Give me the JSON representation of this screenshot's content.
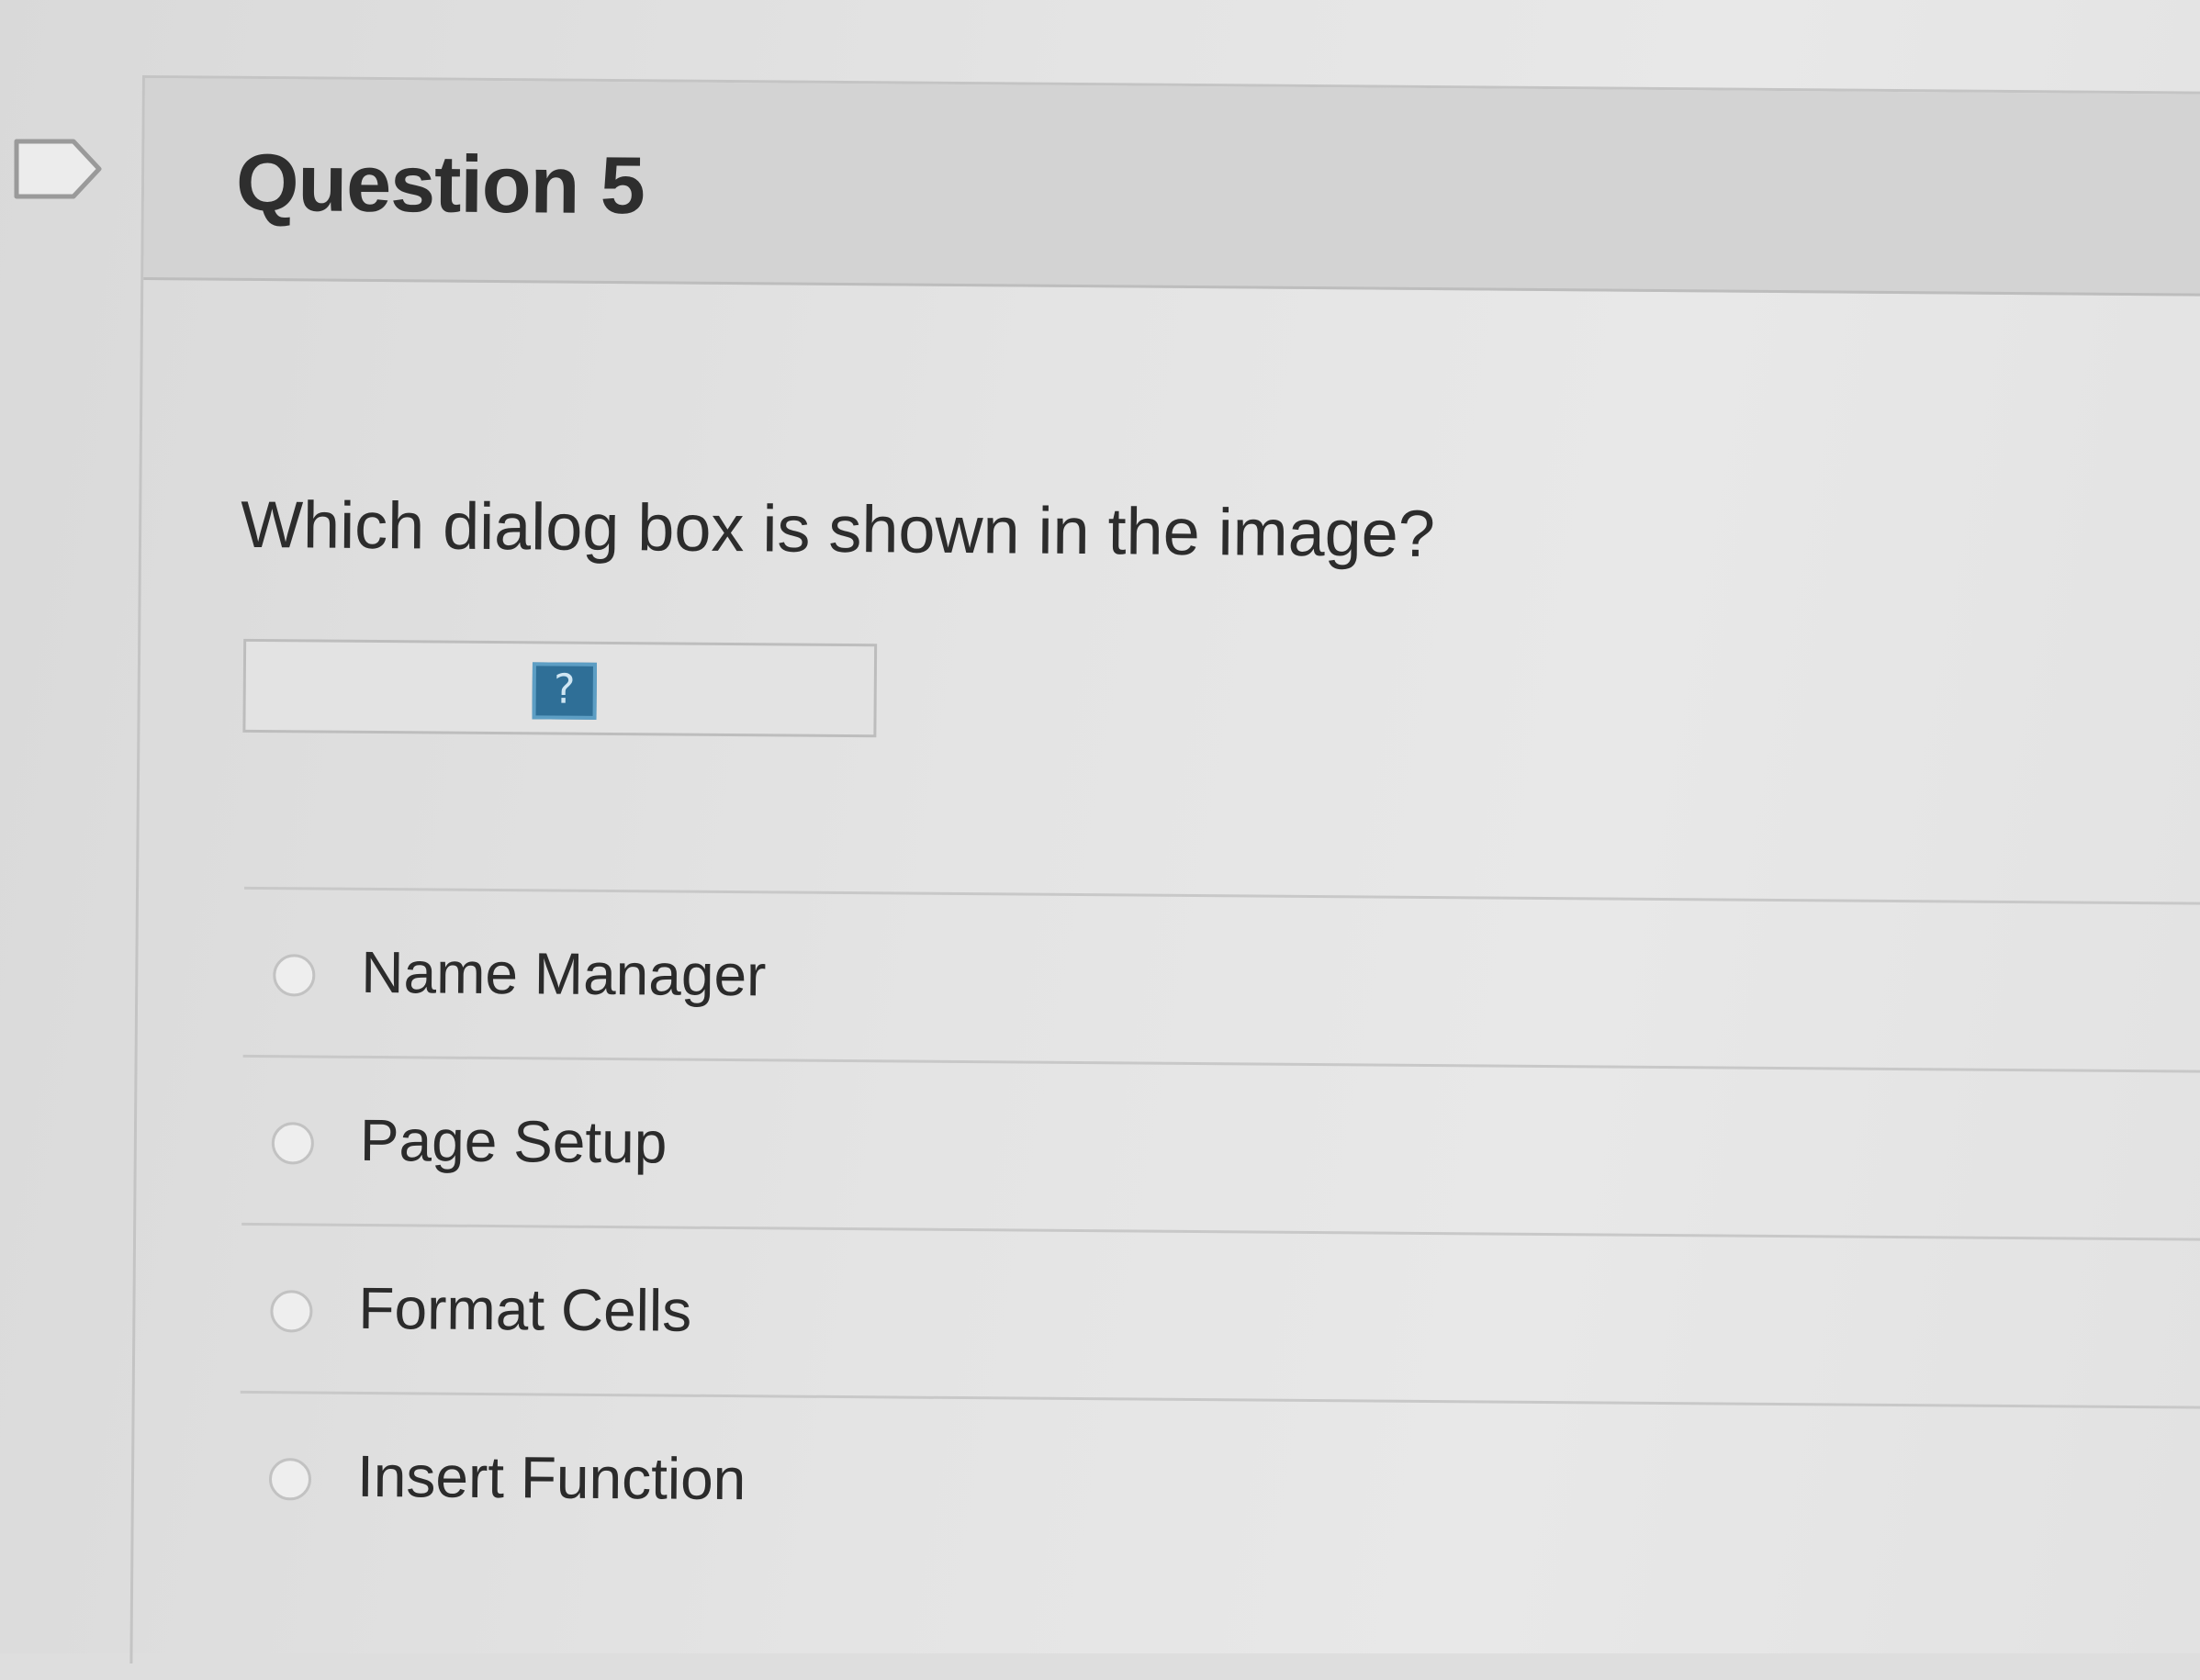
{
  "question": {
    "title": "Question 5",
    "text": "Which dialog box is shown in the image?",
    "image_placeholder_glyph": "?",
    "answers": [
      {
        "label": "Name Manager"
      },
      {
        "label": "Page Setup"
      },
      {
        "label": "Format Cells"
      },
      {
        "label": "Insert Function"
      }
    ]
  },
  "icons": {
    "flag": "flag-outline-icon",
    "broken_image": "broken-image-icon",
    "radio": "radio-unselected-icon"
  },
  "colors": {
    "header_bg": "#d3d3d3",
    "image_icon_bg": "#2f6f97",
    "text": "#2b2b2b"
  }
}
